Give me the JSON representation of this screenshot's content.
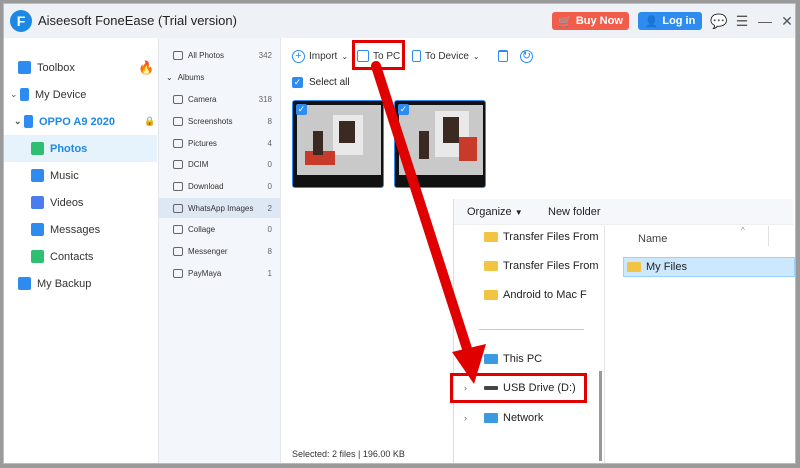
{
  "window": {
    "title": "Aiseesoft FoneEase (Trial version)",
    "buy_now": "Buy Now",
    "log_in": "Log in"
  },
  "leftnav": {
    "toolbox": "Toolbox",
    "my_device": "My Device",
    "device_name": "OPPO A9 2020",
    "items": [
      "Photos",
      "Music",
      "Videos",
      "Messages",
      "Contacts"
    ],
    "my_backup": "My Backup"
  },
  "albums": {
    "all_photos": {
      "label": "All Photos",
      "count": "342"
    },
    "albums_header": "Albums",
    "list": [
      {
        "label": "Camera",
        "count": "318"
      },
      {
        "label": "Screenshots",
        "count": "8"
      },
      {
        "label": "Pictures",
        "count": "4"
      },
      {
        "label": "DCIM",
        "count": "0"
      },
      {
        "label": "Download",
        "count": "0"
      },
      {
        "label": "WhatsApp Images",
        "count": "2"
      },
      {
        "label": "Collage",
        "count": "0"
      },
      {
        "label": "Messenger",
        "count": "8"
      },
      {
        "label": "PayMaya",
        "count": "1"
      }
    ]
  },
  "toolbar": {
    "import": "Import",
    "to_pc": "To PC",
    "to_device": "To Device"
  },
  "select_all": "Select all",
  "status": "Selected: 2 files | 196.00 KB",
  "explorer": {
    "organize": "Organize",
    "new_folder": "New folder",
    "tree": [
      "Transfer Files From",
      "Transfer Files From",
      "Android  to Mac F",
      "This PC",
      "USB Drive (D:)",
      "Network"
    ],
    "column_name": "Name",
    "selected_folder": "My Files"
  },
  "colors": {
    "accent": "#2e8cf0",
    "buy": "#f25c4a",
    "highlight": "#e00000"
  }
}
